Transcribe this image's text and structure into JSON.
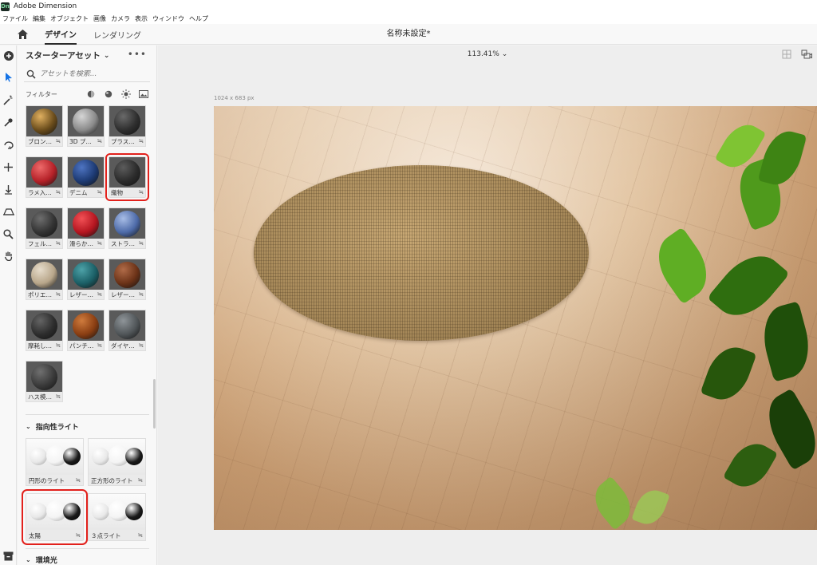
{
  "titlebar": {
    "app_title": "Adobe Dimension",
    "icon_text": "Dn"
  },
  "menu": [
    "ファイル",
    "編集",
    "オブジェクト",
    "画像",
    "カメラ",
    "表示",
    "ウィンドウ",
    "ヘルプ"
  ],
  "tabs": {
    "design": "デザイン",
    "render": "レンダリング"
  },
  "document_title": "名称未設定*",
  "panel": {
    "title": "スターターアセット",
    "search_placeholder": "アセットを検索...",
    "filter_label": "フィルター",
    "materials": [
      {
        "label": "ブロン…",
        "ball": "#6b4d1c",
        "highlight": "#e0b060"
      },
      {
        "label": "3D プ…",
        "ball": "#8a8a8a",
        "highlight": "#d5d5d5"
      },
      {
        "label": "プラス…",
        "ball": "#2e2e2e",
        "highlight": "#6a6a6a"
      },
      {
        "label": "ラメ入…",
        "ball": "#b52128",
        "highlight": "#ee6a6a"
      },
      {
        "label": "デニム",
        "ball": "#1d3a73",
        "highlight": "#4e74c2"
      },
      {
        "label": "織物",
        "ball": "#2b2b2b",
        "highlight": "#5c5c5c",
        "selected": true
      },
      {
        "label": "フェル…",
        "ball": "#333333",
        "highlight": "#6e6e6e"
      },
      {
        "label": "滑らか…",
        "ball": "#b51620",
        "highlight": "#f25055"
      },
      {
        "label": "ストラ…",
        "ball": "#4d6aa8",
        "highlight": "#a8bde6"
      },
      {
        "label": "ポリエ…",
        "ball": "#b8a68a",
        "highlight": "#e6dccb"
      },
      {
        "label": "レザー…",
        "ball": "#1b5f66",
        "highlight": "#4da2a8"
      },
      {
        "label": "レザー…",
        "ball": "#6b3217",
        "highlight": "#b06b48"
      },
      {
        "label": "摩耗し…",
        "ball": "#2d2d2d",
        "highlight": "#646464"
      },
      {
        "label": "パンチ…",
        "ball": "#8a3e12",
        "highlight": "#cf7b3d"
      },
      {
        "label": "ダイヤ…",
        "ball": "#505558",
        "highlight": "#8f9599"
      },
      {
        "label": "ハス模…",
        "ball": "#3a3a3a",
        "highlight": "#707070"
      }
    ],
    "section_lights": "指向性ライト",
    "lights": [
      {
        "label": "円形のライト"
      },
      {
        "label": "正方形のライト"
      },
      {
        "label": "太陽",
        "selected": true
      },
      {
        "label": "３点ライト"
      }
    ],
    "section_env": "環境光"
  },
  "canvas": {
    "zoom": "113.41%",
    "dimensions": "1024 x 683 px"
  },
  "colors": {
    "selection": "#e2211c",
    "accent": "#1473e6"
  }
}
